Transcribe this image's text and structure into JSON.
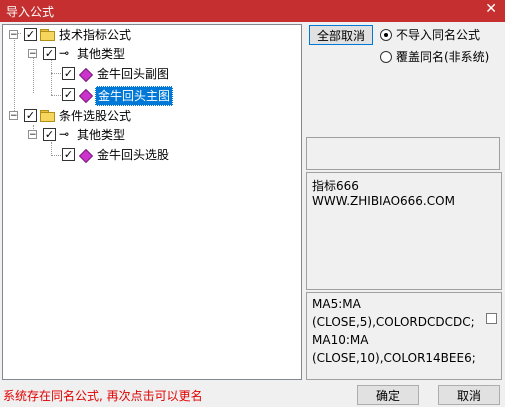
{
  "window": {
    "title": "导入公式",
    "close_glyph": "✕"
  },
  "tree": {
    "nodes": [
      {
        "label": "技术指标公式",
        "checked": true,
        "expanded": true
      },
      {
        "label": "其他类型",
        "checked": true,
        "expanded": true
      },
      {
        "label": "金牛回头副图",
        "checked": true
      },
      {
        "label": "金牛回头主图",
        "checked": true,
        "selected": true
      },
      {
        "label": "条件选股公式",
        "checked": true,
        "expanded": true
      },
      {
        "label": "其他类型",
        "checked": true,
        "expanded": true
      },
      {
        "label": "金牛回头选股",
        "checked": true
      }
    ],
    "check_glyph": "✓",
    "expand_glyph": "−"
  },
  "actions": {
    "deselect_all": "全部取消"
  },
  "options": {
    "no_import_same": "不导入同名公式",
    "overwrite_same": "覆盖同名(非系统)"
  },
  "info": {
    "line1": "指标666",
    "line2": "WWW.ZHIBIAO666.COM"
  },
  "code": {
    "lines": [
      "MA5:MA",
      "(CLOSE,5),COLORDCDCDC;",
      "MA10:MA",
      "(CLOSE,10),COLOR14BEE6;"
    ]
  },
  "footer": {
    "status": "系统存在同名公式, 再次点击可以更名",
    "ok": "确定",
    "cancel": "取消"
  },
  "colors": {
    "title_bar": "#c62f2f",
    "selection": "#0078d7",
    "status_text": "#e00000"
  }
}
